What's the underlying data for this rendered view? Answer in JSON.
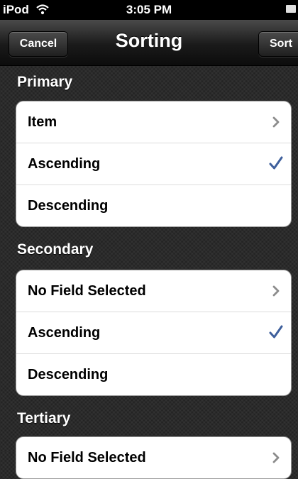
{
  "status_bar": {
    "carrier": "iPod",
    "time": "3:05 PM",
    "icons": [
      "wifi-icon",
      "battery-icon"
    ]
  },
  "nav_bar": {
    "title": "Sorting",
    "left_button": "Cancel",
    "right_button": "Sort"
  },
  "colors": {
    "accent_check": "#3e5f9c",
    "chevron": "#8c8c8c"
  },
  "sections": [
    {
      "header": "Primary",
      "rows": [
        {
          "label": "Item",
          "accessory": "chevron-right-icon"
        },
        {
          "label": "Ascending",
          "accessory": "checkmark-icon"
        },
        {
          "label": "Descending",
          "accessory": ""
        }
      ]
    },
    {
      "header": "Secondary",
      "rows": [
        {
          "label": "No Field Selected",
          "accessory": "chevron-right-icon"
        },
        {
          "label": "Ascending",
          "accessory": "checkmark-icon"
        },
        {
          "label": "Descending",
          "accessory": ""
        }
      ]
    },
    {
      "header": "Tertiary",
      "rows": [
        {
          "label": "No Field Selected",
          "accessory": "chevron-right-icon"
        }
      ]
    }
  ]
}
